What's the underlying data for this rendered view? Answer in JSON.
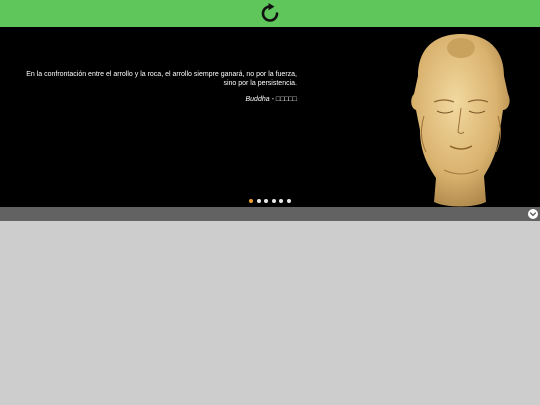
{
  "header": {
    "background_color": "#5ec65b",
    "refresh_icon": "refresh-icon"
  },
  "slider": {
    "quote": "En la confrontación entre el arrollo y la roca, el arrollo siempre ganará, no por la fuerza, sino por la persistencia.",
    "author": "Buddha",
    "author_separator": " - ",
    "author_native": "□□□□□",
    "image": "buddha-head-image",
    "dots_total": 6,
    "active_dot": 1,
    "active_dot_color": "#f0a030"
  },
  "strip": {
    "expand_icon": "chevron-down-icon"
  }
}
